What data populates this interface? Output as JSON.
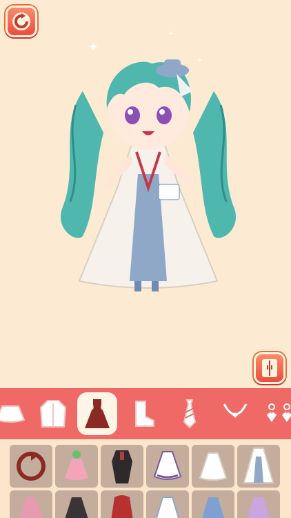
{
  "controls": {
    "reset": {
      "icon": "reset-icon"
    },
    "wardrobe": {
      "icon": "wardrobe-icon"
    }
  },
  "character": {
    "icon": "chibi-girl-character"
  },
  "categories": [
    {
      "icon": "skirt-icon",
      "active": false
    },
    {
      "icon": "jacket-icon",
      "active": false
    },
    {
      "icon": "dress-icon",
      "active": true
    },
    {
      "icon": "boots-icon",
      "active": false
    },
    {
      "icon": "tie-icon",
      "active": false
    },
    {
      "icon": "necklace-icon",
      "active": false
    },
    {
      "icon": "earrings-icon",
      "active": false
    }
  ],
  "items": [
    {
      "icon": "remove-outfit-icon"
    },
    {
      "icon": "pink-flower-dress-icon"
    },
    {
      "icon": "black-suit-outfit-icon"
    },
    {
      "icon": "purple-frill-dress-icon"
    },
    {
      "icon": "white-lace-dress-icon"
    },
    {
      "icon": "white-blue-gown-icon"
    },
    {
      "icon": "pink-ruffle-dress-icon"
    },
    {
      "icon": "black-white-dress-icon"
    },
    {
      "icon": "red-hooded-outfit-icon"
    },
    {
      "icon": "white-blue-dress-icon"
    },
    {
      "icon": "blue-gown-icon"
    },
    {
      "icon": "lavender-dress-icon"
    }
  ],
  "colors": {
    "background": "#fcebd2",
    "accent": "#ef6a67",
    "button": "#e94e3c",
    "slot": "#c5ad9d"
  }
}
